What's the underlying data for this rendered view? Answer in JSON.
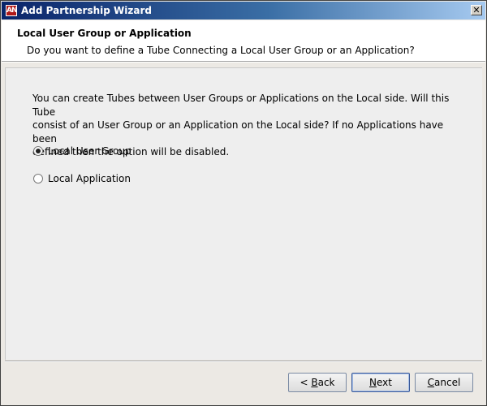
{
  "window": {
    "title": "Add Partnership Wizard",
    "app_icon_text": "AN",
    "close_glyph": "✕"
  },
  "header": {
    "title": "Local User Group or Application",
    "subtitle": "Do you want to define a Tube Connecting a Local User Group or an Application?"
  },
  "content": {
    "description_lines": [
      "You can create Tubes between User Groups or Applications on the Local side.  Will this Tube",
      "consist of an User Group or an Application on the Local side?  If no Applications have been",
      "defined then the option will be disabled."
    ],
    "options": [
      {
        "label": "Local User Group",
        "selected": true
      },
      {
        "label": "Local Application",
        "selected": false
      }
    ]
  },
  "buttons": {
    "back": {
      "prefix": "< ",
      "mnemonic": "B",
      "rest": "ack"
    },
    "next": {
      "prefix": "",
      "mnemonic": "N",
      "rest": "ext"
    },
    "cancel": {
      "prefix": "",
      "mnemonic": "C",
      "rest": "ancel"
    }
  }
}
